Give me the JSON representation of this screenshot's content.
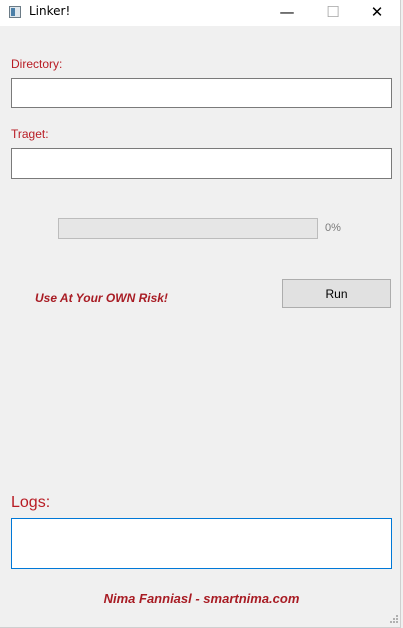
{
  "window": {
    "title": "Linker!",
    "minimize_glyph": "—",
    "maximize_glyph": "☐",
    "close_glyph": "✕",
    "app_icon": "window-app-icon"
  },
  "form": {
    "directory_label": "Directory:",
    "directory_value": "",
    "target_label": "Traget:",
    "target_value": ""
  },
  "progress": {
    "value": 0,
    "text": "0%"
  },
  "warning_text": "Use At Your OWN Risk!",
  "run_label": "Run",
  "logs": {
    "label": "Logs:",
    "value": ""
  },
  "footer_text": "Nima Fanniasl - smartnima.com",
  "colors": {
    "label_red": "#b81c24",
    "progress_green": "#06b025",
    "focus_blue": "#0078d7"
  }
}
